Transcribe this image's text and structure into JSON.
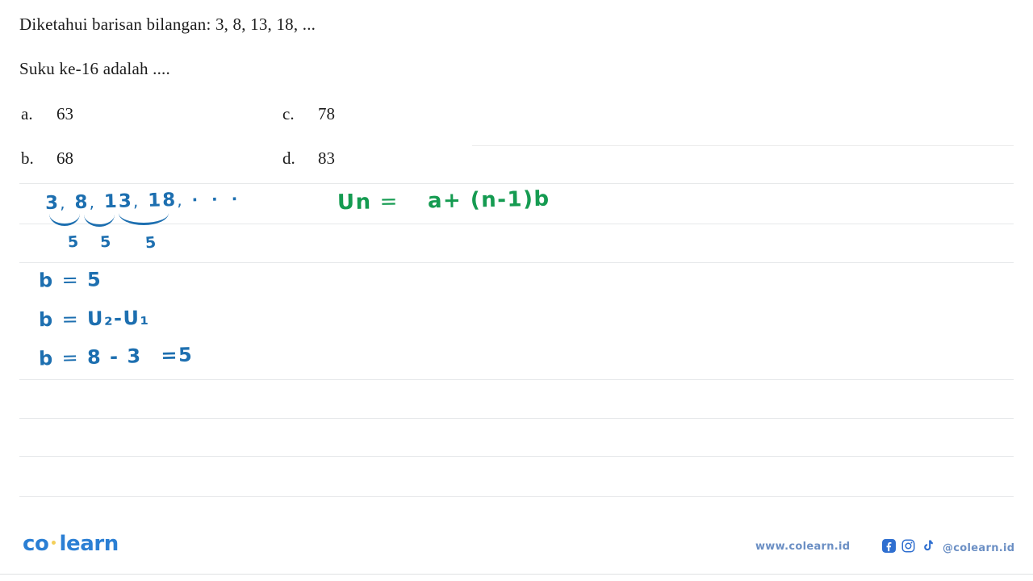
{
  "question": {
    "line1": "Diketahui barisan bilangan: 3, 8, 13, 18, ...",
    "line2": "Suku ke-16 adalah ...."
  },
  "options": [
    {
      "label": "a.",
      "value": "63"
    },
    {
      "label": "b.",
      "value": "68"
    },
    {
      "label": "c.",
      "value": "78"
    },
    {
      "label": "d.",
      "value": "83"
    }
  ],
  "annotations": {
    "sequence": {
      "terms": [
        "3",
        "8",
        "13",
        "18"
      ],
      "separator": ",",
      "ellipsis": "· · ·",
      "differences": [
        "5",
        "5",
        "5"
      ]
    },
    "formula": {
      "lhs": "Un",
      "equals": "=",
      "rhs": "a+ (n-1)b"
    },
    "work": [
      {
        "lhs": "b",
        "equals": "=",
        "rhs": "5"
      },
      {
        "lhs": "b",
        "equals": "=",
        "rhs": "U₂-U₁"
      },
      {
        "lhs": "b",
        "equals": "=",
        "rhs": "8 - 3",
        "result": "=5"
      }
    ]
  },
  "footer": {
    "logo_left": "co",
    "logo_right": "learn",
    "website": "www.colearn.id",
    "handle": "@colearn.id",
    "icons": [
      "facebook-icon",
      "instagram-icon",
      "tiktok-icon"
    ]
  },
  "colors": {
    "ink_blue": "#1d6fb0",
    "ink_green": "#159b51",
    "brand_blue": "#2b7fd4",
    "brand_yellow": "#f3cf5a",
    "rule_gray": "#e6e8ea"
  }
}
